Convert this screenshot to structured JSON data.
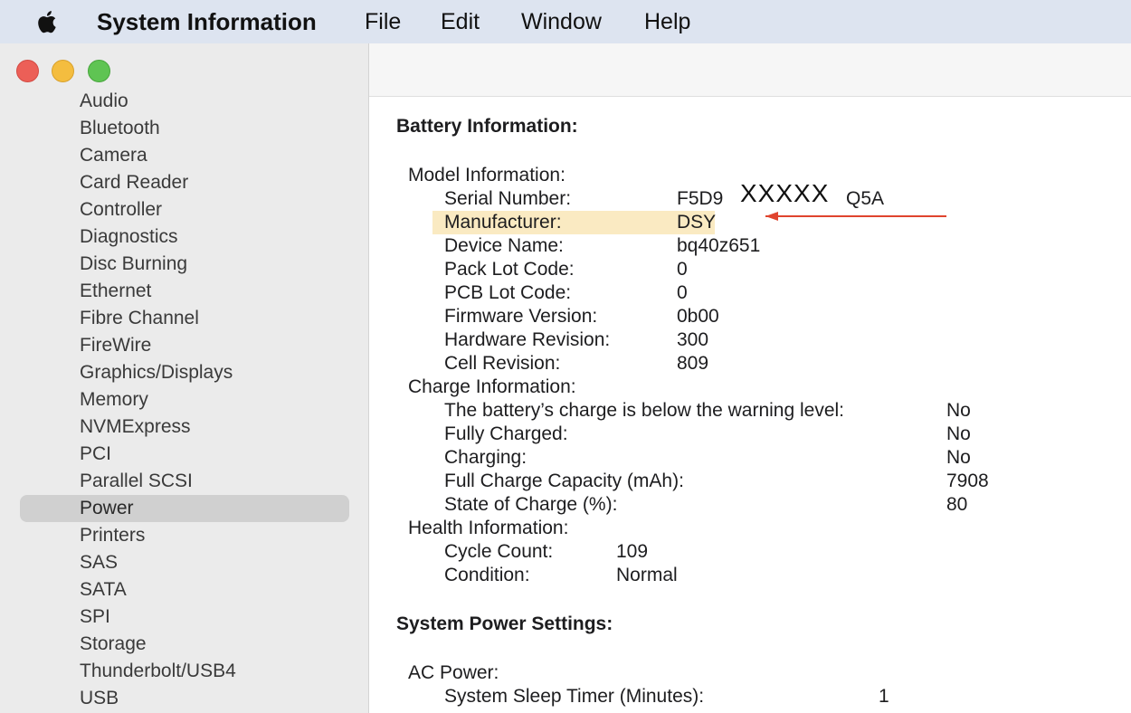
{
  "menubar": {
    "app_name": "System Information",
    "menus": [
      "File",
      "Edit",
      "Window",
      "Help"
    ]
  },
  "sidebar": {
    "items": [
      "Audio",
      "Bluetooth",
      "Camera",
      "Card Reader",
      "Controller",
      "Diagnostics",
      "Disc Burning",
      "Ethernet",
      "Fibre Channel",
      "FireWire",
      "Graphics/Displays",
      "Memory",
      "NVMExpress",
      "PCI",
      "Parallel SCSI",
      "Power",
      "Printers",
      "SAS",
      "SATA",
      "SPI",
      "Storage",
      "Thunderbolt/USB4",
      "USB"
    ],
    "selected": "Power"
  },
  "content": {
    "battery_title": "Battery Information:",
    "model_header": "Model Information:",
    "model": [
      {
        "label": "Serial Number:",
        "value": "F5D9",
        "value_tail": "Q5A"
      },
      {
        "label": "Manufacturer:",
        "value": "DSY"
      },
      {
        "label": "Device Name:",
        "value": "bq40z651"
      },
      {
        "label": "Pack Lot Code:",
        "value": "0"
      },
      {
        "label": "PCB Lot Code:",
        "value": "0"
      },
      {
        "label": "Firmware Version:",
        "value": "0b00"
      },
      {
        "label": "Hardware Revision:",
        "value": "300"
      },
      {
        "label": "Cell Revision:",
        "value": "809"
      }
    ],
    "redaction_marks": "XXXXX",
    "charge_header": "Charge Information:",
    "charge": [
      {
        "label": "The battery’s charge is below the warning level:",
        "value": "No"
      },
      {
        "label": "Fully Charged:",
        "value": "No"
      },
      {
        "label": "Charging:",
        "value": "No"
      },
      {
        "label": "Full Charge Capacity (mAh):",
        "value": "7908"
      },
      {
        "label": "State of Charge (%):",
        "value": "80"
      }
    ],
    "health_header": "Health Information:",
    "health": [
      {
        "label": "Cycle Count:",
        "value": "109"
      },
      {
        "label": "Condition:",
        "value": "Normal"
      }
    ],
    "power_title": "System Power Settings:",
    "ac_header": "AC Power:",
    "ac": [
      {
        "label": "System Sleep Timer (Minutes):",
        "value": "1"
      }
    ]
  },
  "colors": {
    "highlight": "#faeac2",
    "arrow": "#e0442e",
    "selected_row": "#d0d0d0"
  }
}
